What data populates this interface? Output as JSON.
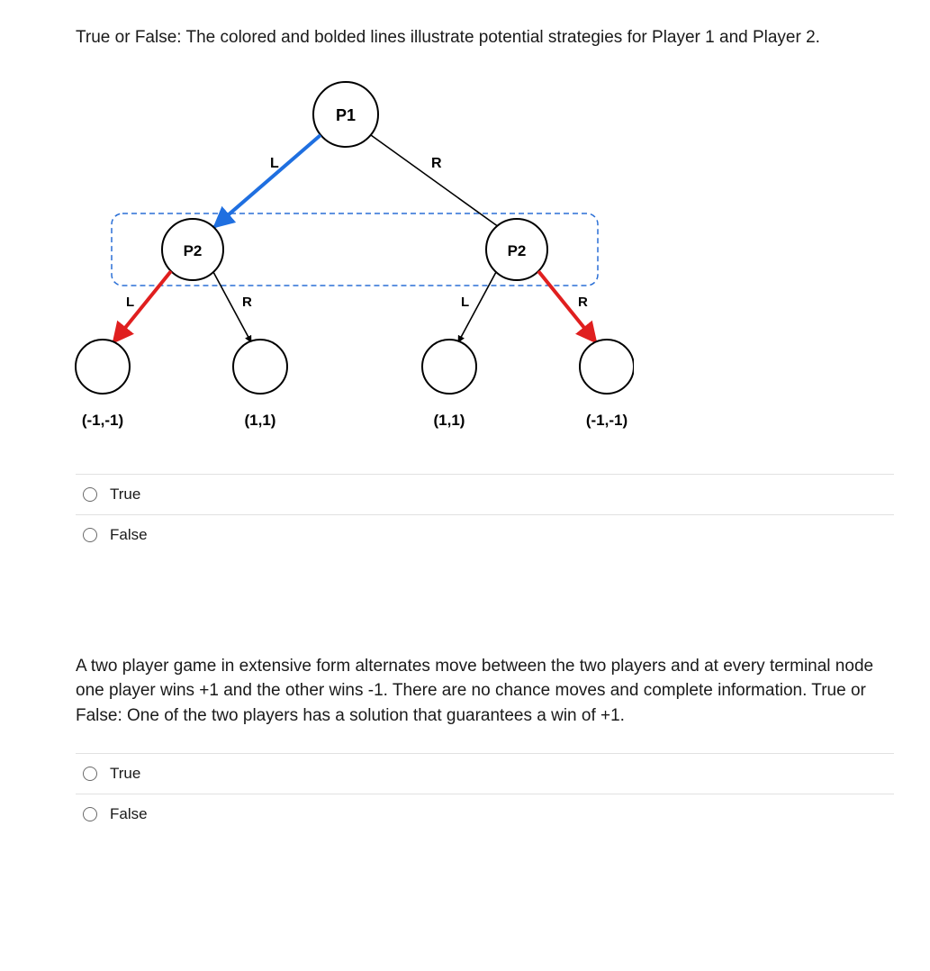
{
  "question1": {
    "prompt": "True or False: The colored and bolded lines illustrate potential strategies for Player 1 and Player 2.",
    "diagram": {
      "root_label": "P1",
      "root_children": [
        {
          "edge_label": "L",
          "node_label": "P2",
          "bold": true,
          "color": "#1f6fe0"
        },
        {
          "edge_label": "R",
          "node_label": "P2",
          "bold": false,
          "color": "#000000"
        }
      ],
      "left_p2_children": [
        {
          "edge_label": "L",
          "payoff": "(-1,-1)",
          "bold": true,
          "color": "#e01f1f"
        },
        {
          "edge_label": "R",
          "payoff": "(1,1)",
          "bold": false,
          "color": "#000000"
        }
      ],
      "right_p2_children": [
        {
          "edge_label": "L",
          "payoff": "(1,1)",
          "bold": false,
          "color": "#000000"
        },
        {
          "edge_label": "R",
          "payoff": "(-1,-1)",
          "bold": true,
          "color": "#e01f1f"
        }
      ],
      "information_set": "dashed box grouping both P2 nodes"
    },
    "options": [
      "True",
      "False"
    ]
  },
  "question2": {
    "prompt": "A two player game in extensive form alternates move between the two players and at every terminal node one player wins +1 and the other wins -1. There are no chance moves and complete information. True or False: One of the two players has a solution that guarantees a win of +1.",
    "options": [
      "True",
      "False"
    ]
  },
  "chart_data": {
    "type": "tree",
    "title": "Extensive-form game tree",
    "root": {
      "player": "P1",
      "children": [
        {
          "move": "L",
          "highlighted": true,
          "highlight_color": "blue",
          "player": "P2",
          "children": [
            {
              "move": "L",
              "highlighted": true,
              "highlight_color": "red",
              "payoff": [
                -1,
                -1
              ]
            },
            {
              "move": "R",
              "highlighted": false,
              "payoff": [
                1,
                1
              ]
            }
          ]
        },
        {
          "move": "R",
          "highlighted": false,
          "player": "P2",
          "children": [
            {
              "move": "L",
              "highlighted": false,
              "payoff": [
                1,
                1
              ]
            },
            {
              "move": "R",
              "highlighted": true,
              "highlight_color": "red",
              "payoff": [
                -1,
                -1
              ]
            }
          ]
        }
      ],
      "information_sets": [
        {
          "players_grouped": "both P2 nodes",
          "style": "dashed-rounded-rectangle"
        }
      ]
    }
  }
}
